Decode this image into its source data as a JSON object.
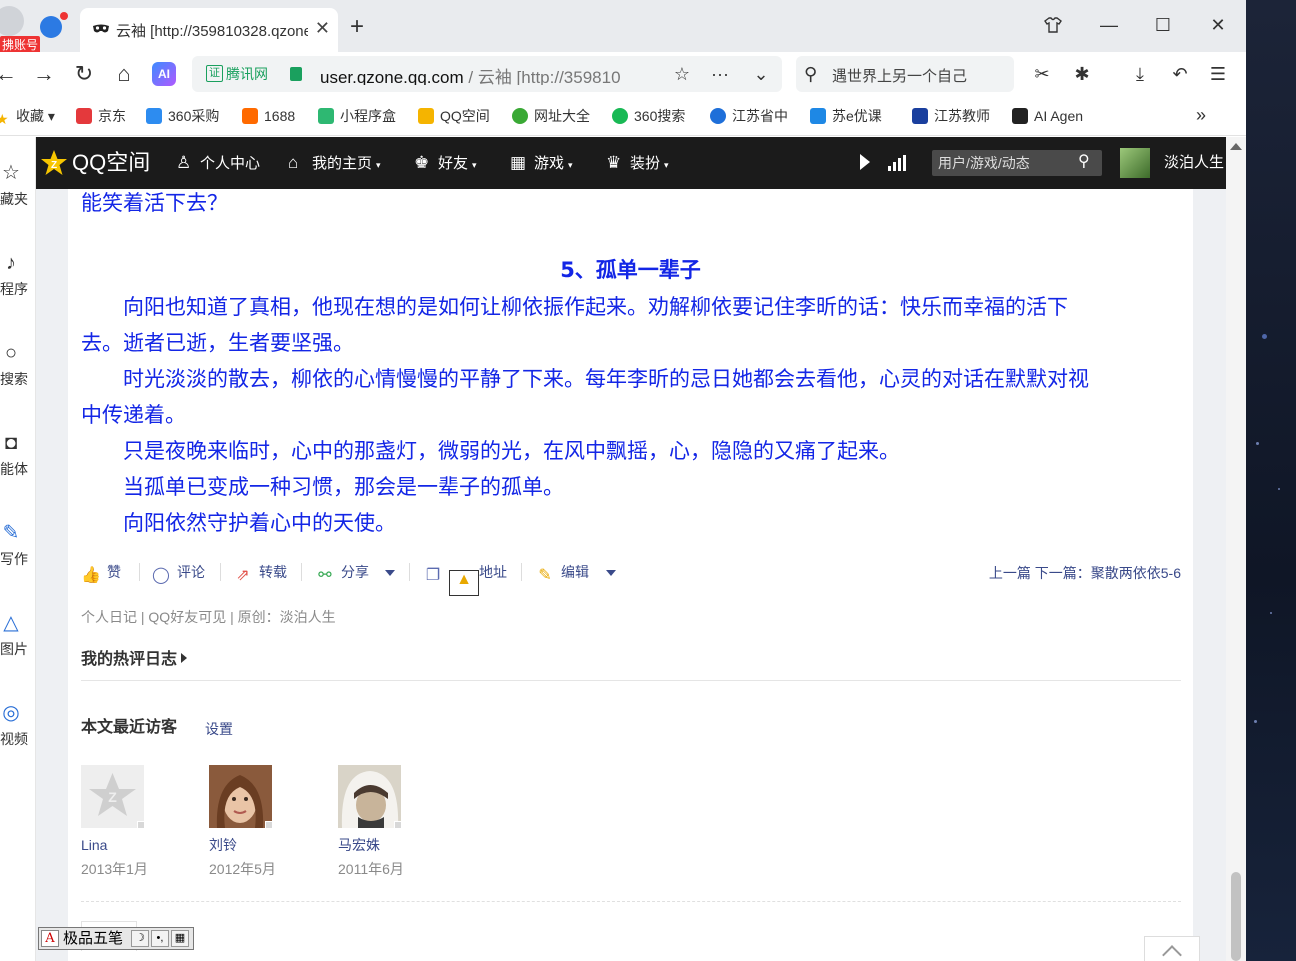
{
  "browser": {
    "profile_badge": "拂账号",
    "tab": {
      "title": "云袖 [http://359810328.qzone"
    },
    "address": {
      "cert_label": "腾讯网",
      "url_host": "user.qzone.qq.com",
      "url_rest": " / 云袖 [http://359810",
      "more_label": "···"
    },
    "search": {
      "text": "遇世界上另一个自己"
    },
    "bookmarks": [
      {
        "label": "收藏",
        "icon": "star-icon",
        "color": "#f5b400"
      },
      {
        "label": "京东",
        "icon": "jd-icon",
        "color": "#e4393c"
      },
      {
        "label": "360采购",
        "icon": "360-buy-icon",
        "color": "#2d8cf0"
      },
      {
        "label": "1688",
        "icon": "1688-icon",
        "color": "#ff6a00"
      },
      {
        "label": "小程序盒",
        "icon": "miniapp-icon",
        "color": "#2eb872"
      },
      {
        "label": "QQ空间",
        "icon": "qzone-icon",
        "color": "#f5b400"
      },
      {
        "label": "网址大全",
        "icon": "sites-icon",
        "color": "#3aa935"
      },
      {
        "label": "360搜索",
        "icon": "360-search-icon",
        "color": "#19b955"
      },
      {
        "label": "江苏省中",
        "icon": "jiangsu-icon",
        "color": "#1e6fd9"
      },
      {
        "label": "苏e优课",
        "icon": "sue-icon",
        "color": "#1e88e5"
      },
      {
        "label": "江苏教师",
        "icon": "teacher-icon",
        "color": "#1a3f9e"
      },
      {
        "label": "AI Agen",
        "icon": "ai-agent-icon",
        "color": "#222222"
      }
    ],
    "bookmarks_more": "»"
  },
  "sidepanel": [
    {
      "label": "藏夹",
      "icon": "star-icon",
      "glyph": "☆"
    },
    {
      "label": "程序",
      "icon": "miniapp-icon",
      "glyph": "♪"
    },
    {
      "label": "搜索",
      "icon": "search-icon",
      "glyph": "○"
    },
    {
      "label": "能体",
      "icon": "agent-icon",
      "glyph": "◘"
    },
    {
      "label": "写作",
      "icon": "write-icon",
      "glyph": "✎"
    },
    {
      "label": "图片",
      "icon": "image-icon",
      "glyph": "△"
    },
    {
      "label": "视频",
      "icon": "video-icon",
      "glyph": "◎"
    }
  ],
  "qzone_nav": {
    "logo": "QQ空间",
    "items": [
      {
        "label": "个人中心",
        "icon": "person-icon",
        "glyph": "♙",
        "caret": ""
      },
      {
        "label": "我的主页",
        "icon": "home-icon",
        "glyph": "⌂",
        "caret": "▾"
      },
      {
        "label": "好友",
        "icon": "friends-icon",
        "glyph": "♚",
        "caret": "▾"
      },
      {
        "label": "游戏",
        "icon": "games-icon",
        "glyph": "▦",
        "caret": "▾"
      },
      {
        "label": "装扮",
        "icon": "dressup-icon",
        "glyph": "♛",
        "caret": "▾"
      }
    ],
    "search_placeholder": "用户/游戏/动态",
    "username": "淡泊人生"
  },
  "article": {
    "lead_line": "能笑着活下去？",
    "section_title": "5、孤单一辈子",
    "paragraphs": [
      {
        "lines": [
          "　　向阳也知道了真相，他现在想的是如何让柳依振作起来。劝解柳依要记住李昕的话：快乐而幸福的活下",
          "去。逝者已逝，生者要坚强。"
        ]
      },
      {
        "lines": [
          "　　时光淡淡的散去，柳依的心情慢慢的平静了下来。每年李昕的忌日她都会去看他，心灵的对话在默默对视",
          "中传递着。"
        ]
      },
      {
        "lines": [
          "　　只是夜晚来临时，心中的那盏灯，微弱的光，在风中飘摇，心，隐隐的又痛了起来。"
        ]
      },
      {
        "lines": [
          "　　当孤单已变成一种习惯，那会是一辈子的孤单。"
        ]
      },
      {
        "lines": [
          "　　向阳依然守护着心中的天使。"
        ]
      }
    ],
    "actions": {
      "like": "赞",
      "comment": "评论",
      "repost": "转载",
      "share": "分享",
      "address": "地址",
      "edit": "编辑"
    },
    "prev_next": "上一篇 下一篇：聚散两依依5-6",
    "meta": "个人日记 | QQ好友可见 | 原创：淡泊人生",
    "hot_title": "我的热评日志",
    "visitors_title": "本文最近访客",
    "visitors_settings": "设置",
    "visitors": [
      {
        "name": "Lina",
        "date": "2013年1月",
        "avatar": "default-qzone-avatar"
      },
      {
        "name": "刘铃",
        "date": "2012年5月",
        "avatar": "girl-photo-avatar"
      },
      {
        "name": "马宏姝",
        "date": "2011年6月",
        "avatar": "hooded-photo-avatar"
      }
    ]
  },
  "ime": {
    "mode": "A",
    "name": "极品五笔",
    "moon": "☽",
    "punct": "•,",
    "keyboard": "▦"
  },
  "colors": {
    "article_text": "#1326e6",
    "link": "#3a4a8a",
    "qzone_bar": "#1b1b1b",
    "cert_green": "#1aa05e"
  }
}
